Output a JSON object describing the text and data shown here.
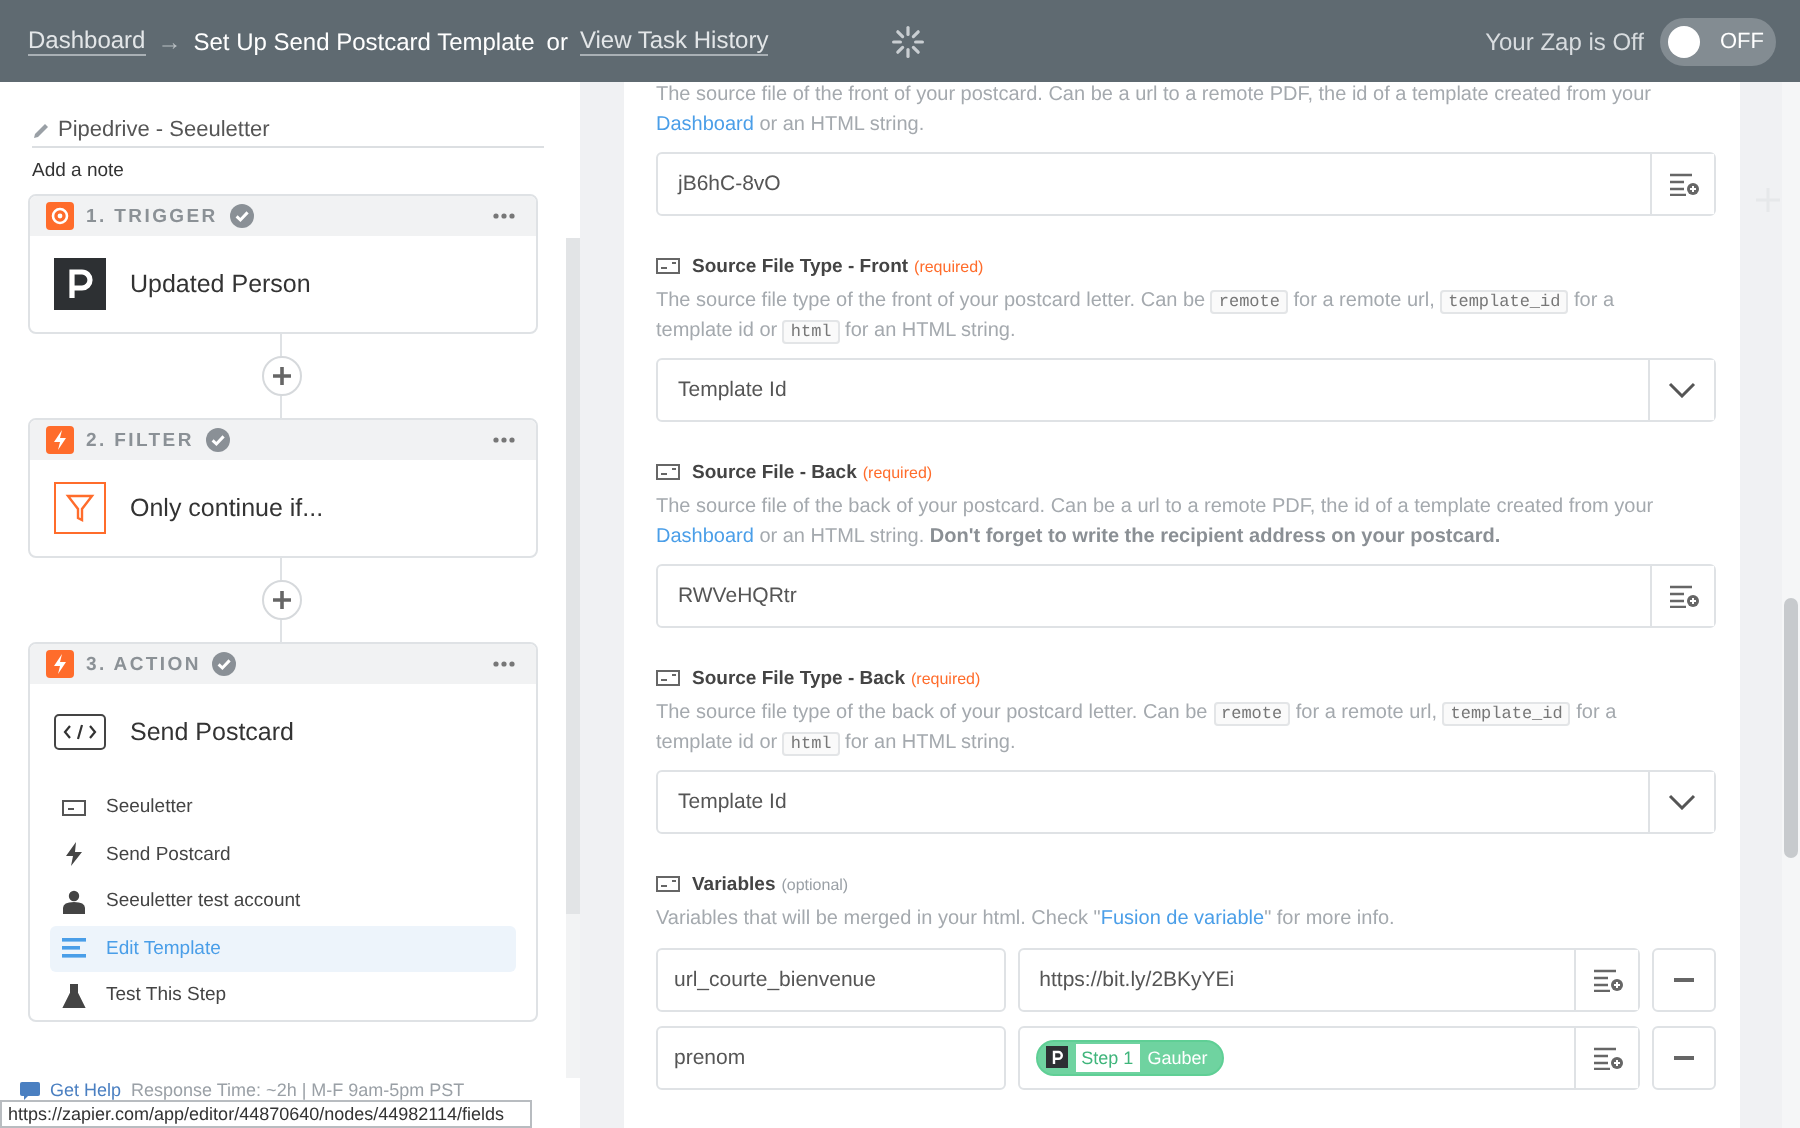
{
  "topbar": {
    "breadcrumb": "Dashboard",
    "arrow": "→",
    "title": "Set Up Send Postcard Template",
    "separator": "or",
    "history_link": "View Task History",
    "zap_status": "Your Zap is Off",
    "toggle": {
      "on": false,
      "label": "OFF"
    }
  },
  "sidebar": {
    "zap_name": "Pipedrive - Seeuletter",
    "note_link": "Add a note",
    "steps": [
      {
        "kind": "trigger",
        "label": "1. TRIGGER",
        "checked": true,
        "app": "Updated Person"
      },
      {
        "kind": "filter",
        "label": "2. FILTER",
        "checked": true,
        "app": "Only continue if..."
      },
      {
        "kind": "action",
        "label": "3. ACTION",
        "checked": true,
        "app": "Send Postcard",
        "items": [
          {
            "kind": "app",
            "label": "Seeuletter",
            "selected": false
          },
          {
            "kind": "event",
            "label": "Send Postcard",
            "selected": false
          },
          {
            "kind": "account",
            "label": "Seeuletter test account",
            "selected": false
          },
          {
            "kind": "template",
            "label": "Edit Template",
            "selected": true
          },
          {
            "kind": "test",
            "label": "Test This Step",
            "selected": false
          }
        ]
      }
    ],
    "help": {
      "link": "Get Help",
      "text": "Response Time: ~2h | M-F 9am-5pm PST"
    },
    "status_url": "https://zapier.com/app/editor/44870640/nodes/44982114/fields"
  },
  "form": {
    "fields": [
      {
        "kind": "text",
        "description": [
          {
            "kind": "plain",
            "text": "The source file of the front of your postcard. Can be a url to a remote PDF, the id of a template created from your "
          },
          {
            "kind": "link",
            "text": "Dashboard"
          },
          {
            "kind": "plain",
            "text": " or an HTML string."
          }
        ],
        "value": "jB6hC-8vO"
      },
      {
        "kind": "select",
        "label": "Source File Type - Front",
        "tag": "(required)",
        "description": [
          {
            "kind": "plain",
            "text": "The source file type of the front of your postcard letter. Can be "
          },
          {
            "kind": "code",
            "text": "remote"
          },
          {
            "kind": "plain",
            "text": " for a remote url, "
          },
          {
            "kind": "code",
            "text": "template_id"
          },
          {
            "kind": "plain",
            "text": " for a template id or "
          },
          {
            "kind": "code",
            "text": "html"
          },
          {
            "kind": "plain",
            "text": " for an HTML string."
          }
        ],
        "value": "Template Id"
      },
      {
        "kind": "text",
        "label": "Source File - Back",
        "tag": "(required)",
        "description": [
          {
            "kind": "plain",
            "text": "The source file of the back of your postcard. Can be a url to a remote PDF, the id of a template created from your "
          },
          {
            "kind": "link",
            "text": "Dashboard"
          },
          {
            "kind": "plain",
            "text": " or an HTML string. **Don't forget to write the recipient address on your postcard.**"
          }
        ],
        "value": "RWVeHQRtr"
      },
      {
        "kind": "select",
        "label": "Source File Type - Back",
        "tag": "(required)",
        "description": [
          {
            "kind": "plain",
            "text": "The source file type of the back of your postcard letter. Can be "
          },
          {
            "kind": "code",
            "text": "remote"
          },
          {
            "kind": "plain",
            "text": " for a remote url, "
          },
          {
            "kind": "code",
            "text": "template_id"
          },
          {
            "kind": "plain",
            "text": " for a template id or "
          },
          {
            "kind": "code",
            "text": "html"
          },
          {
            "kind": "plain",
            "text": " for an HTML string."
          }
        ],
        "value": "Template Id"
      },
      {
        "kind": "pairs",
        "label": "Variables",
        "tag": "(optional)",
        "description": [
          {
            "kind": "plain",
            "text": "Variables that will be merged in your html. Check \""
          },
          {
            "kind": "link",
            "text": "Fusion de variable"
          },
          {
            "kind": "plain",
            "text": "\" for more info."
          }
        ],
        "rows": [
          {
            "key": "url_courte_bienvenue",
            "value": {
              "kind": "text",
              "text": "https://bit.ly/2BKyYEi"
            }
          },
          {
            "key": "prenom",
            "value": {
              "kind": "token",
              "step": "Step 1",
              "text": "Gauber"
            }
          }
        ]
      }
    ]
  }
}
